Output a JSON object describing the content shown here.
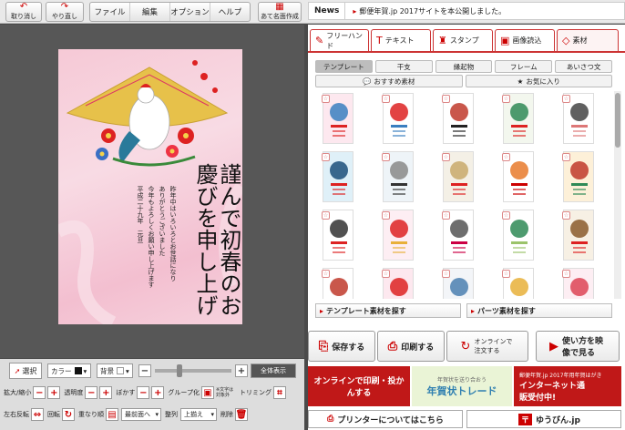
{
  "toolbar": {
    "undo": "取り消し",
    "redo": "やり直し",
    "menu": [
      "ファイル",
      "編集",
      "オプション",
      "ヘルプ"
    ],
    "address_create": "あて名面作成"
  },
  "news": {
    "label": "News",
    "text": "郵便年賀.jp 2017サイトを本公開しました。"
  },
  "card": {
    "main_text": "謹んで初春のお慶びを申し上げます",
    "body_lines": [
      "昨年中はいろいろとお世話になり",
      "ありがとうございました",
      "今年もよろしくお願い申し上げます",
      "平成二十九年　元旦"
    ]
  },
  "tabs": [
    "フリーハンド",
    "テキスト",
    "スタンプ",
    "画像読込",
    "素材"
  ],
  "subtabs_row1": [
    "テンプレート",
    "干支",
    "縁起物",
    "フレーム",
    "あいさつ文"
  ],
  "subtabs_row2": [
    "おすすめ素材",
    "お気に入り"
  ],
  "search": {
    "template": "テンプレート素材を探す",
    "parts": "パーツ素材を探す"
  },
  "actions": {
    "save": "保存する",
    "print": "印刷する",
    "order": "オンラインで注文する",
    "howto": "使い方を映像で見る"
  },
  "banners": {
    "online_print": "オンラインで印刷・投かんする",
    "trade": "年賀状トレード",
    "trade_sub": "年賀状を送り合おう",
    "internet": "インターネット通販受付中!",
    "internet_sub": "郵便年賀.jp 2017年用年賀はがき"
  },
  "bottom": {
    "printer": "プリンターについてはこちら",
    "yubin": "ゆうびん.jp"
  },
  "tools": {
    "select": "選択",
    "color": "カラー",
    "background": "背景",
    "show_all": "全体表示",
    "scale": "拡大/縮小",
    "opacity": "透明度",
    "blur": "ぼかす",
    "group": "グループ化",
    "trimming": "トリミング",
    "flip": "左右反転",
    "rotate": "回転",
    "order": "重なり順",
    "front": "最前面へ",
    "align": "整列",
    "align_value": "上揃え",
    "delete": "削除",
    "group_note": "※文字は対象外"
  },
  "colors": {
    "accent": "#cc2222",
    "canvas": "#575757",
    "card_pink": "#f6c9d6"
  }
}
